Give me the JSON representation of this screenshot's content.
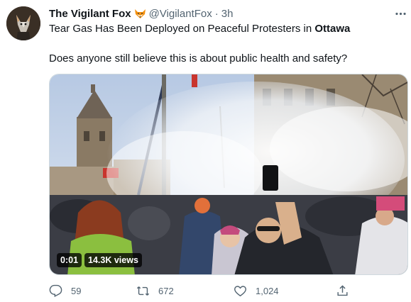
{
  "tweet": {
    "display_name": "The Vigilant Fox",
    "handle": "@VigilantFox",
    "separator": "·",
    "time": "3h",
    "line1_prefix": "Tear Gas Has Been Deployed on Peaceful Protesters in ",
    "line1_hashtag": "Ottawa",
    "line2": "Does anyone still believe this is about public health and safety?",
    "media": {
      "timestamp": "0:01",
      "views": "14.3K views"
    },
    "actions": {
      "replies": "59",
      "retweets": "672",
      "likes": "1,024"
    }
  },
  "colors": {
    "text": "#0f1419",
    "secondary": "#536471",
    "border": "#cfd9de"
  },
  "icons": [
    "fox-emoji-icon",
    "more-icon",
    "reply-icon",
    "retweet-icon",
    "like-icon",
    "share-icon"
  ]
}
